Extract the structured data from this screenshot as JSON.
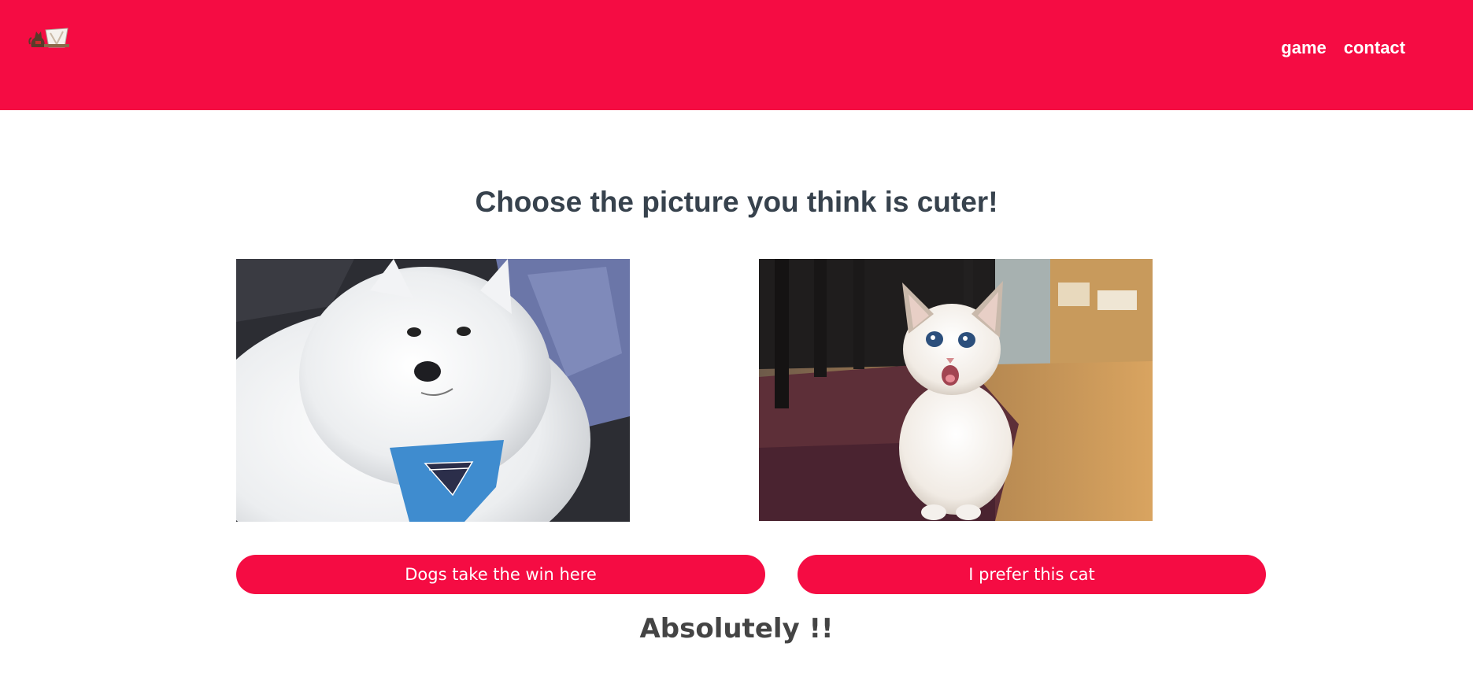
{
  "header": {
    "background_color": "#f50c43",
    "logo_icon": "cat-dog-logo-icon",
    "nav": [
      {
        "label": "game"
      },
      {
        "label": "contact"
      }
    ]
  },
  "main": {
    "heading": "Choose the picture you think is cuter!",
    "images": [
      {
        "subject": "white fluffy dog with blue bandana",
        "icon": "dog-photo"
      },
      {
        "subject": "white kitten on rug",
        "icon": "cat-photo"
      }
    ],
    "buttons": [
      {
        "label": "Dogs take the win here"
      },
      {
        "label": "I prefer this cat"
      }
    ],
    "result_text": "Absolutely !!"
  },
  "colors": {
    "accent": "#f50c43",
    "heading": "#37424d",
    "result": "#444444"
  }
}
